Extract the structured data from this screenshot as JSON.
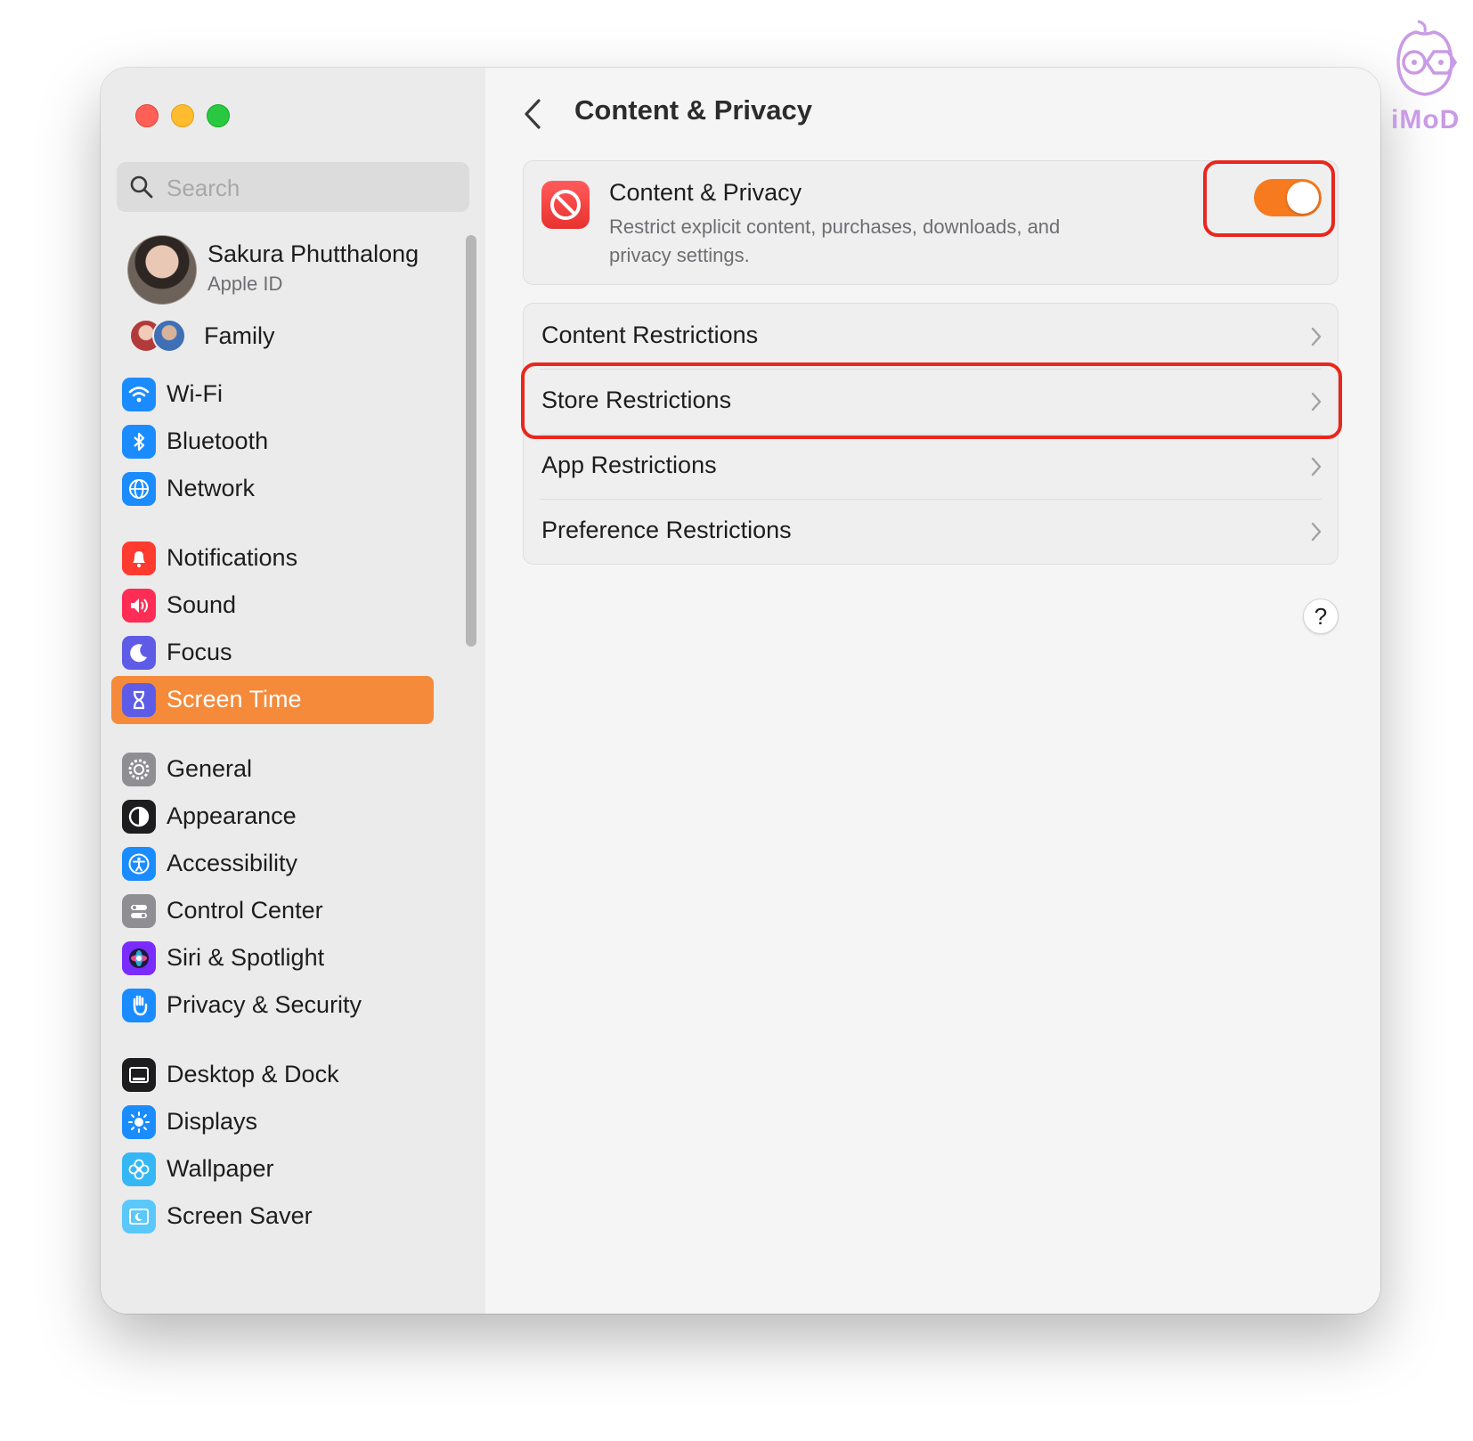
{
  "window": {
    "traffic_lights": [
      "close",
      "minimize",
      "zoom"
    ]
  },
  "search": {
    "placeholder": "Search",
    "value": ""
  },
  "account": {
    "name": "Sakura Phutthalong",
    "subtitle": "Apple ID"
  },
  "family": {
    "label": "Family"
  },
  "sidebar": {
    "selected": "Screen Time",
    "selected_color": "#f58a3b",
    "items": [
      {
        "label": "Wi-Fi",
        "icon": "wifi-icon",
        "color": "#1a8cff"
      },
      {
        "label": "Bluetooth",
        "icon": "bluetooth-icon",
        "color": "#1a8cff"
      },
      {
        "label": "Network",
        "icon": "globe-icon",
        "color": "#1a8cff"
      },
      {
        "label": "Notifications",
        "icon": "bell-icon",
        "color": "#ff3b30"
      },
      {
        "label": "Sound",
        "icon": "speaker-icon",
        "color": "#ff2d55"
      },
      {
        "label": "Focus",
        "icon": "moon-icon",
        "color": "#5e5ce6"
      },
      {
        "label": "Screen Time",
        "icon": "hourglass-icon",
        "color": "#5e5ce6"
      },
      {
        "label": "General",
        "icon": "gear-icon",
        "color": "#8e8e93"
      },
      {
        "label": "Appearance",
        "icon": "appearance-icon",
        "color": "#1d1d1f"
      },
      {
        "label": "Accessibility",
        "icon": "accessibility-icon",
        "color": "#1a8cff"
      },
      {
        "label": "Control Center",
        "icon": "control-center-icon",
        "color": "#8e8e93"
      },
      {
        "label": "Siri & Spotlight",
        "icon": "siri-icon",
        "color": "#7a2cff"
      },
      {
        "label": "Privacy & Security",
        "icon": "hand-icon",
        "color": "#1a8cff"
      },
      {
        "label": "Desktop & Dock",
        "icon": "dock-icon",
        "color": "#1d1d1f"
      },
      {
        "label": "Displays",
        "icon": "sun-icon",
        "color": "#1a8cff"
      },
      {
        "label": "Wallpaper",
        "icon": "flower-icon",
        "color": "#35b7f5"
      },
      {
        "label": "Screen Saver",
        "icon": "screen-saver-icon",
        "color": "#5ac8fa"
      }
    ]
  },
  "page": {
    "title": "Content & Privacy"
  },
  "content_privacy": {
    "title": "Content & Privacy",
    "description": "Restrict explicit content, purchases, downloads, and privacy settings.",
    "enabled": true,
    "toggle_color": "#f77a1f",
    "icon": "restriction-icon"
  },
  "restrictions": [
    {
      "label": "Content Restrictions"
    },
    {
      "label": "Store Restrictions"
    },
    {
      "label": "App Restrictions"
    },
    {
      "label": "Preference Restrictions"
    }
  ],
  "help": {
    "label": "?"
  },
  "annotations": {
    "highlight_color": "#e8271e",
    "highlighted": [
      "toggle",
      "Store Restrictions"
    ]
  },
  "watermark": {
    "text": "iMoD"
  }
}
